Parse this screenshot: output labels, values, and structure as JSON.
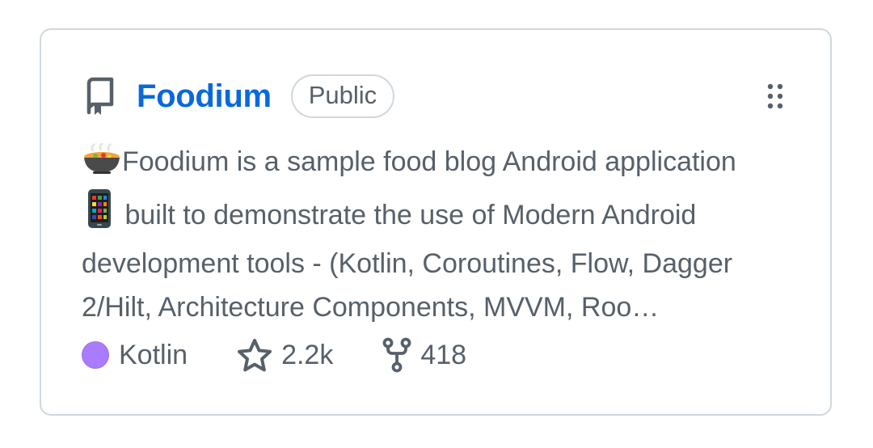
{
  "repo": {
    "name": "Foodium",
    "visibility": "Public",
    "description": "Foodium is a sample food blog Android application",
    "description_line2": " built to demonstrate the use of Modern Android development tools - (Kotlin, Coroutines, Flow, Dagger 2/Hilt, Architecture Components, MVVM, Roo…",
    "leading_emoji": "stew-pot-emoji",
    "inline_emoji": "mobile-phone-emoji"
  },
  "language": {
    "name": "Kotlin",
    "color": "#A97BFF"
  },
  "stats": {
    "stars": "2.2k",
    "forks": "418"
  },
  "icons": {
    "repo": "repo-icon",
    "menu": "kebab-menu-icon",
    "star": "star-icon",
    "fork": "fork-icon"
  },
  "colors": {
    "link": "#0969da",
    "muted": "#57606a",
    "border": "#d0d7de"
  }
}
